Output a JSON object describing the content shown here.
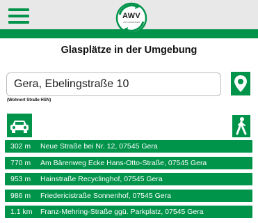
{
  "header": {
    "logo": {
      "text": "AWV",
      "subtext": "OSTTHÜRINGEN"
    },
    "menu_icon": "hamburger-icon"
  },
  "page": {
    "title": "Glasplätze in der Umgebung"
  },
  "search": {
    "value": "Gera, Ebelingstraße 10",
    "hint": "(Wohnort Straße HSN)",
    "location_icon": "map-pin-icon"
  },
  "modes": {
    "car_icon": "car-icon",
    "walk_icon": "walking-person-icon"
  },
  "results": [
    {
      "distance": "302 m",
      "address": "Neue Straße bei Nr. 12, 07545 Gera"
    },
    {
      "distance": "770 m",
      "address": "Am Bärenweg Ecke Hans-Otto-Straße, 07545 Gera"
    },
    {
      "distance": "953 m",
      "address": "Hainstraße Recyclinghof, 07545 Gera"
    },
    {
      "distance": "986 m",
      "address": "Friedericistraße Sonnenhof, 07545 Gera"
    },
    {
      "distance": "1.1 km",
      "address": "Franz-Mehring-Straße ggü. Parkplatz, 07545 Gera"
    }
  ],
  "colors": {
    "accent": "#00934a",
    "header_bg": "#e8e8e8",
    "text": "#111111"
  }
}
